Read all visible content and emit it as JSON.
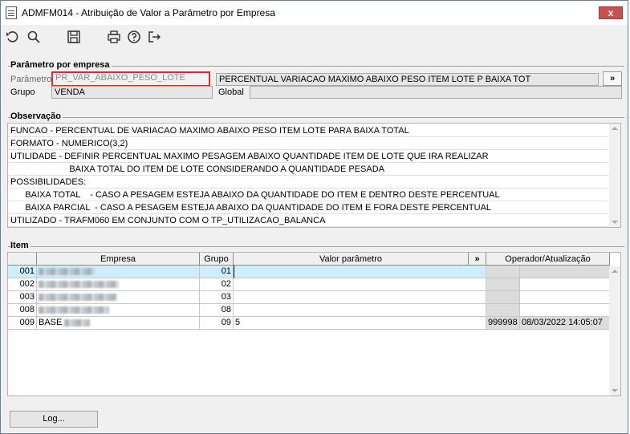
{
  "window": {
    "title": "ADMFM014 - Atribuição de Valor a Parâmetro por Empresa",
    "close_label": "x"
  },
  "toolbar": {
    "icons": [
      "undo-icon",
      "search-icon",
      "save-icon",
      "print-icon",
      "help-icon",
      "exit-icon"
    ]
  },
  "param_group": {
    "title": "Parâmetro por empresa",
    "parametro_label": "Parâmetro",
    "parametro_value": "PR_VAR_ABAIXO_PESO_LOTE",
    "description_value": "PERCENTUAL VARIACAO MAXIMO ABAIXO PESO ITEM LOTE P BAIXA TOT",
    "expand_label": "»",
    "grupo_label": "Grupo",
    "grupo_value": "VENDA",
    "global_label": "Global",
    "global_value": ""
  },
  "observacao": {
    "title": "Observação",
    "lines": [
      "FUNCAO - PERCENTUAL DE VARIACAO MAXIMO ABAIXO PESO ITEM LOTE PARA BAIXA TOTAL",
      "FORMATO - NUMERICO(3,2)",
      "UTILIDADE - DEFINIR PERCENTUAL MAXIMO PESAGEM ABAIXO QUANTIDADE ITEM DE LOTE QUE IRA REALIZAR",
      "                        BAIXA TOTAL DO ITEM DE LOTE CONSIDERANDO A QUANTIDADE PESADA",
      "POSSIBILIDADES:",
      "      BAIXA TOTAL    - CASO A PESAGEM ESTEJA ABAIXO DA QUANTIDADE DO ITEM E DENTRO DESTE PERCENTUAL",
      "      BAIXA PARCIAL  - CASO A PESAGEM ESTEJA ABAIXO DA QUANTIDADE DO ITEM E FORA DESTE PERCENTUAL",
      "UTILIZADO - TRAFM060 EM CONJUNTO COM O TP_UTILIZACAO_BALANCA"
    ]
  },
  "item": {
    "title": "Item",
    "headers": {
      "empresa": "Empresa",
      "grupo": "Grupo",
      "valor": "Valor parâmetro",
      "expand": "»",
      "operador": "Operador/Atualização"
    },
    "rows": [
      {
        "code": "001",
        "empresa": "",
        "grupo": "01",
        "valor": "",
        "operador": "",
        "data": ""
      },
      {
        "code": "002",
        "empresa": "",
        "grupo": "02",
        "valor": "",
        "operador": "",
        "data": ""
      },
      {
        "code": "003",
        "empresa": "",
        "grupo": "03",
        "valor": "",
        "operador": "",
        "data": ""
      },
      {
        "code": "008",
        "empresa": "",
        "grupo": "08",
        "valor": "",
        "operador": "",
        "data": ""
      },
      {
        "code": "009",
        "empresa": "BASE",
        "grupo": "09",
        "valor": "5",
        "operador": "999998",
        "data": "08/03/2022 14:05:07"
      }
    ]
  },
  "footer": {
    "log_label": "Log..."
  }
}
